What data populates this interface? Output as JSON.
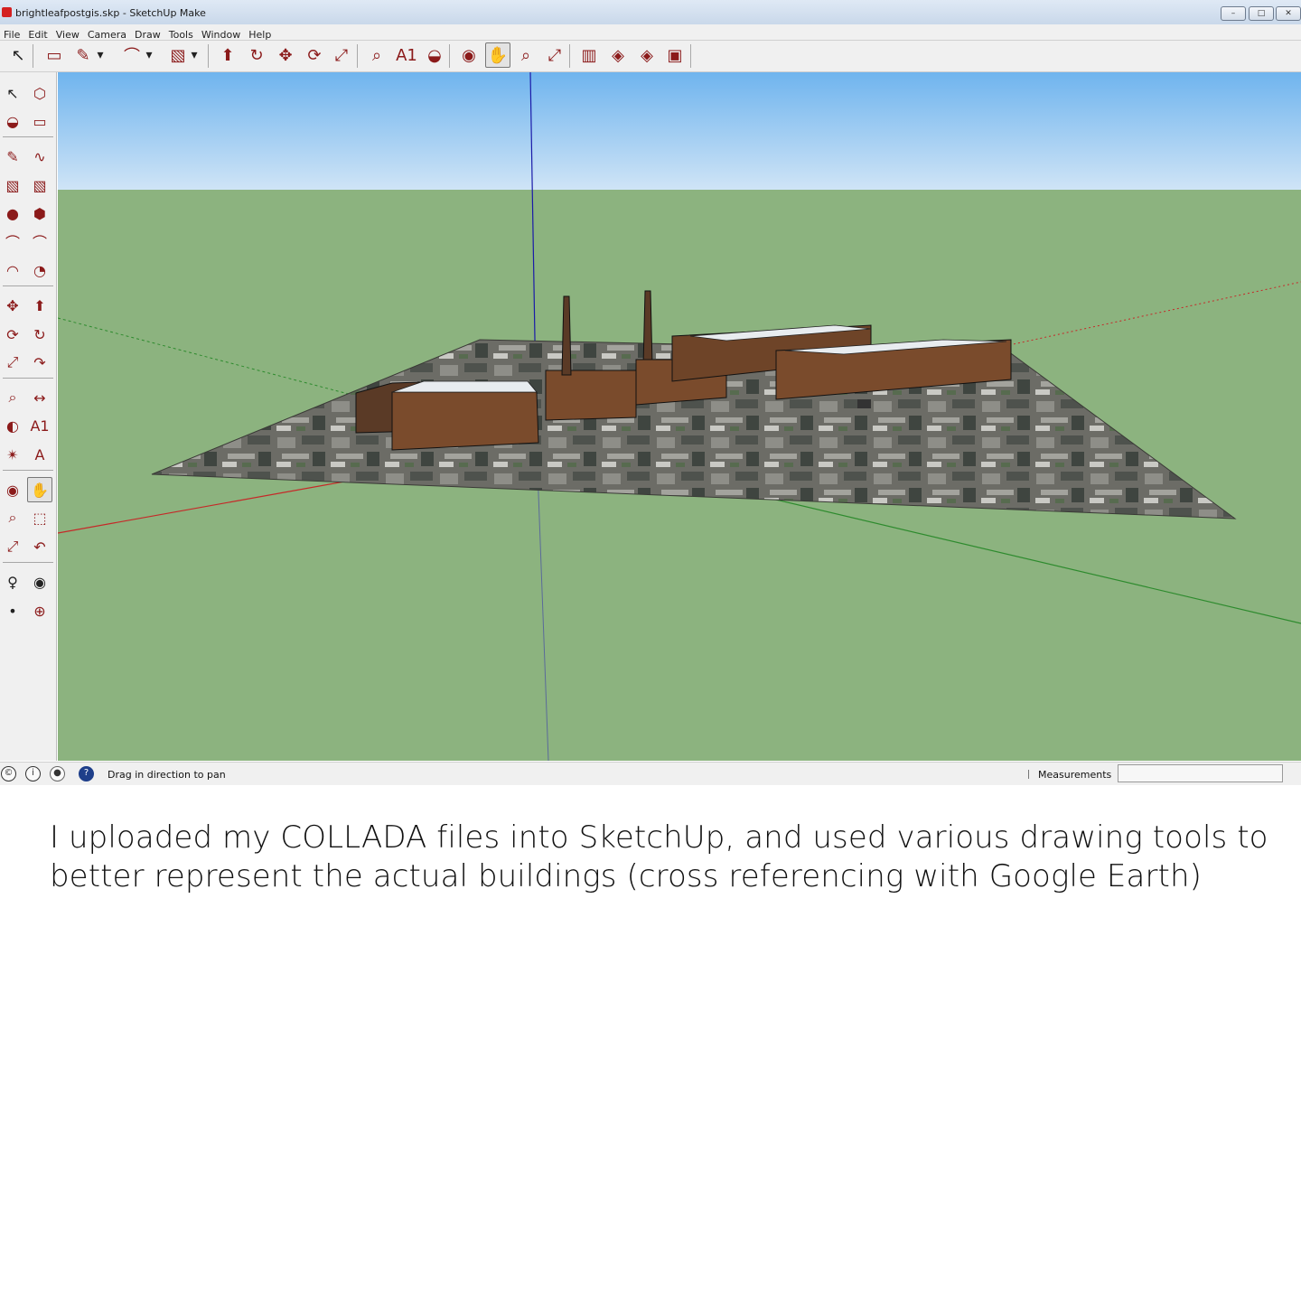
{
  "window": {
    "title": "brightleafpostgis.skp - SketchUp Make",
    "buttons": {
      "minimize": "–",
      "maximize": "□",
      "close": "✕"
    }
  },
  "menu": [
    "File",
    "Edit",
    "View",
    "Camera",
    "Draw",
    "Tools",
    "Window",
    "Help"
  ],
  "toolbar": {
    "tools": [
      {
        "name": "select",
        "glyph": "↖"
      },
      {
        "name": "eraser",
        "glyph": "▭"
      },
      {
        "name": "pencil",
        "glyph": "✎"
      },
      {
        "name": "dropdown",
        "glyph": "▾"
      },
      {
        "name": "arc",
        "glyph": "⌒"
      },
      {
        "name": "dropdown",
        "glyph": "▾"
      },
      {
        "name": "rectangle",
        "glyph": "▧"
      },
      {
        "name": "dropdown",
        "glyph": "▾"
      },
      {
        "name": "push-pull",
        "glyph": "⬆"
      },
      {
        "name": "follow-me",
        "glyph": "↻"
      },
      {
        "name": "move",
        "glyph": "✥"
      },
      {
        "name": "rotate",
        "glyph": "⟳"
      },
      {
        "name": "scale",
        "glyph": "⤢"
      },
      {
        "name": "tape-measure",
        "glyph": "⌕"
      },
      {
        "name": "text",
        "glyph": "A1"
      },
      {
        "name": "paint-bucket",
        "glyph": "◒"
      },
      {
        "name": "orbit",
        "glyph": "◉"
      },
      {
        "name": "pan",
        "glyph": "✋"
      },
      {
        "name": "zoom",
        "glyph": "⌕"
      },
      {
        "name": "zoom-extents",
        "glyph": "⤢"
      },
      {
        "name": "warehouse",
        "glyph": "▥"
      },
      {
        "name": "components",
        "glyph": "◈"
      },
      {
        "name": "extension-warehouse",
        "glyph": "◈"
      },
      {
        "name": "send-to-layout",
        "glyph": "▣"
      }
    ],
    "selected": "pan"
  },
  "left_tools": [
    [
      "select",
      "component"
    ],
    [
      "paint-bucket",
      "eraser"
    ],
    [
      "pencil",
      "freehand"
    ],
    [
      "rectangle",
      "rotated-rectangle"
    ],
    [
      "circle",
      "polygon"
    ],
    [
      "arc",
      "2-point-arc"
    ],
    [
      "3-point-arc",
      "pie"
    ],
    [
      "move",
      "push-pull"
    ],
    [
      "rotate",
      "follow-me"
    ],
    [
      "scale",
      "offset"
    ],
    [
      "tape-measure",
      "dimension"
    ],
    [
      "protractor",
      "text"
    ],
    [
      "axes",
      "3d-text"
    ],
    [
      "orbit",
      "pan"
    ],
    [
      "zoom",
      "zoom-window"
    ],
    [
      "zoom-extents",
      "previous"
    ],
    [
      "position-camera",
      "look-around"
    ],
    [
      "walk",
      "section-plane"
    ]
  ],
  "left_glyphs": {
    "select": "↖",
    "component": "⬡",
    "paint-bucket": "◒",
    "eraser": "▭",
    "pencil": "✎",
    "freehand": "∿",
    "rectangle": "▧",
    "rotated-rectangle": "▧",
    "circle": "●",
    "polygon": "⬢",
    "arc": "⌒",
    "2-point-arc": "⌒",
    "3-point-arc": "◠",
    "pie": "◔",
    "move": "✥",
    "push-pull": "⬆",
    "rotate": "⟳",
    "follow-me": "↻",
    "scale": "⤢",
    "offset": "↷",
    "tape-measure": "⌕",
    "dimension": "↔",
    "protractor": "◐",
    "text": "A1",
    "axes": "✴",
    "3d-text": "A",
    "orbit": "◉",
    "pan": "✋",
    "zoom": "⌕",
    "zoom-window": "⬚",
    "zoom-extents": "⤢",
    "previous": "↶",
    "position-camera": "♀",
    "look-around": "◉",
    "walk": "•",
    "section-plane": "⊕"
  },
  "selected_left_tool": "pan",
  "status": {
    "icons": [
      "credits-icon",
      "info-icon",
      "user-icon",
      "help-icon"
    ],
    "text": "Drag in direction to pan",
    "measurements_label": "Measurements",
    "measurements_value": ""
  },
  "colors": {
    "sky_top": "#6fb4ee",
    "sky_bottom": "#cfe4f6",
    "ground": "#8cb37f",
    "building": "#7a4b2c",
    "roof": "#e8ecef",
    "red_axis": "#c62828",
    "green_axis": "#2e8b2e",
    "blue_axis": "#1a1aa8"
  },
  "caption": "I uploaded my COLLADA files into SketchUp, and used various drawing tools to better represent the actual buildings (cross referencing with Google Earth)"
}
